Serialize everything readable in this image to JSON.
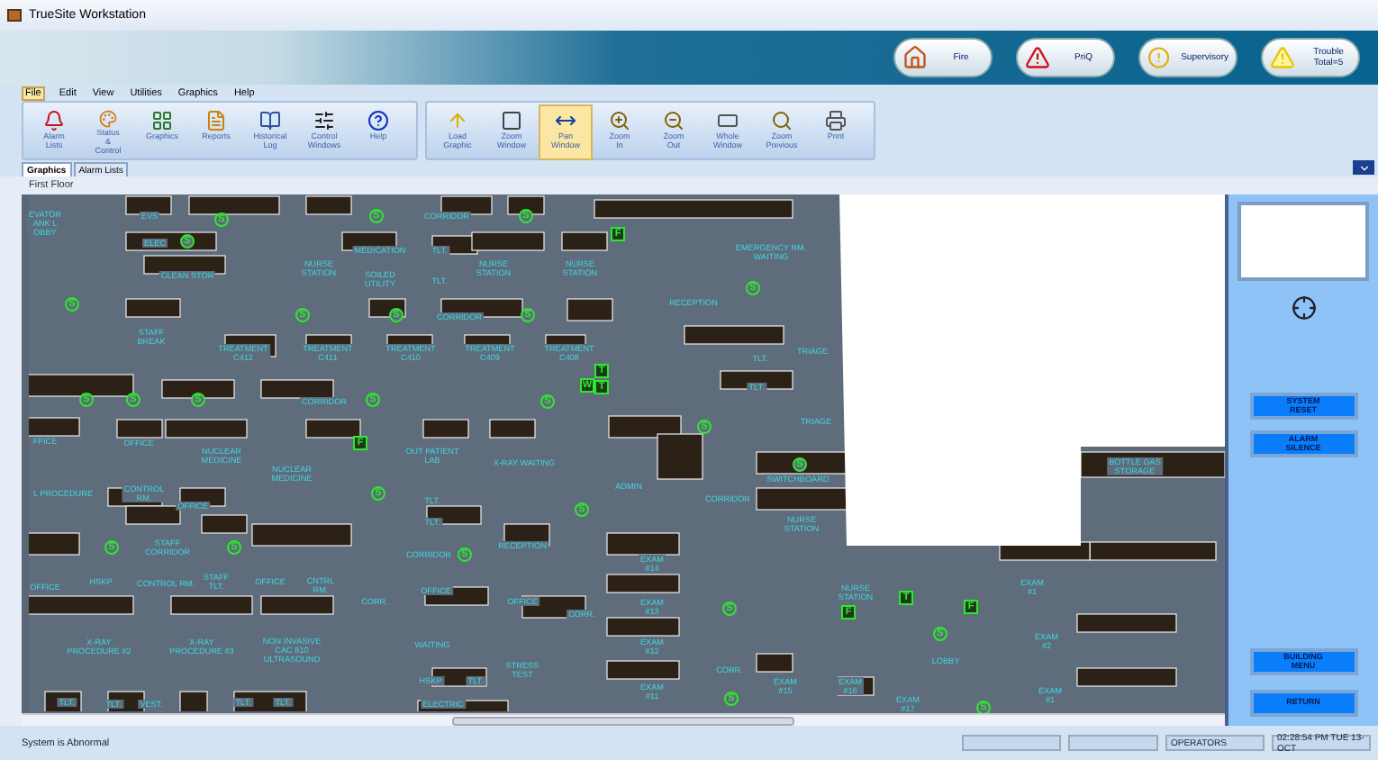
{
  "window": {
    "title": "TrueSite Workstation"
  },
  "alarm_buttons": [
    {
      "kind": "fire",
      "label": "Fire"
    },
    {
      "kind": "priority",
      "label": "PriQ"
    },
    {
      "kind": "supervisory",
      "label": "Supervisory"
    },
    {
      "kind": "trouble",
      "label": "Trouble\nTotal=5"
    }
  ],
  "menu": [
    {
      "label": "File",
      "selected": true
    },
    {
      "label": "Edit",
      "selected": false
    },
    {
      "label": "View",
      "selected": false
    },
    {
      "label": "Utilities",
      "selected": false
    },
    {
      "label": "Graphics",
      "selected": false
    },
    {
      "label": "Help",
      "selected": false
    }
  ],
  "toolbar_groups": [
    [
      {
        "kind": "alarm",
        "label": "Alarm\nLists",
        "selected": false
      },
      {
        "kind": "status",
        "label": "Status &\nControl",
        "selected": false
      },
      {
        "kind": "graphics",
        "label": "Graphics",
        "selected": false
      },
      {
        "kind": "reports",
        "label": "Reports",
        "selected": false
      },
      {
        "kind": "log",
        "label": "Historical\nLog",
        "selected": false
      },
      {
        "kind": "control",
        "label": "Control\nWindows",
        "selected": false
      },
      {
        "kind": "help",
        "label": "Help",
        "selected": false
      }
    ],
    [
      {
        "kind": "load",
        "label": "Load\nGraphic",
        "selected": false
      },
      {
        "kind": "zoomwindow",
        "label": "Zoom\nWindow",
        "selected": false
      },
      {
        "kind": "pan",
        "label": "Pan\nWindow",
        "selected": true
      },
      {
        "kind": "zoomin",
        "label": "Zoom\nIn",
        "selected": false
      },
      {
        "kind": "zoomout",
        "label": "Zoom\nOut",
        "selected": false
      },
      {
        "kind": "whole",
        "label": "Whole\nWindow",
        "selected": false
      },
      {
        "kind": "zoomprev",
        "label": "Zoom\nPrevious",
        "selected": false
      },
      {
        "kind": "print",
        "label": "Print",
        "selected": false
      }
    ]
  ],
  "tabs": [
    {
      "label": "Graphics",
      "selected": true
    },
    {
      "label": "Alarm Lists",
      "selected": false
    }
  ],
  "floor": {
    "title": "First Floor",
    "rooms": [
      "EVATOR\nANK L\nOBBY",
      "EVS",
      "CORRIDOR",
      "ELEC",
      "MEDICATION",
      "TLT.",
      "CLEAN STOR",
      "NURSE\nSTATION",
      "SOILED\nUTILITY",
      "TLT.",
      "NURSE\nSTATION",
      "NURSE\nSTATION",
      "CORRIDOR",
      "STAFF\nBREAK",
      "TREATMENT\nC412",
      "TREATMENT\nC411",
      "TREATMENT\nC410",
      "TREATMENT\nC409",
      "TREATMENT\nC408",
      "CORRIDOR",
      "FFICE",
      "OFFICE",
      "NUCLEAR\nMEDICINE",
      "OUT PATIENT\nLAB",
      "X-RAY WAITING",
      "NUCLEAR\nMEDICINE",
      "L PROCEDURE",
      "CONTROL\nRM.",
      "OFFICE",
      "TLT.",
      "TLT.",
      "STAFF\nCORRIDOR",
      "CORRIDOR",
      "RECEPTION",
      "OFFICE",
      "HSKP",
      "CONTROL RM.",
      "STAFF\nTLT.",
      "OFFICE",
      "CNTRL\nRM.",
      "CORR.",
      "OFFICE",
      "OFFICE",
      "CORR.",
      "X-RAY\nPROCEDURE #2",
      "X-RAY\nPROCEDURE #3",
      "NON INVASIVE\nCAC 810\nULTRASOUND",
      "WAITING",
      "STRESS\nTEST",
      "HSKP",
      "TLT.",
      "TLT.",
      "TLT.",
      "VEST.",
      "TLT.",
      "TLT.",
      "ELECTRIC",
      "EMERGENCY RM.\nWAITING",
      "RECEPTION",
      "TLT.",
      "TRIAGE",
      "TLT.",
      "TRIAGE",
      "SWITCHBOARD",
      "ADMIN",
      "CORRIDOR",
      "NURSE\nSTATION",
      "BOTTLE GAS\nSTORAGE",
      "EXAM\n#14",
      "EXAM\n#1",
      "NURSE\nSTATION",
      "EXAM\n#13",
      "EXAM\n#12",
      "EXAM\n#2",
      "LOBBY",
      "EXAM\n#11",
      "CORR.",
      "EXAM\n#15",
      "EXAM\n#16",
      "EXAM\n#17",
      "EXAM\n#1"
    ],
    "devices": [
      {
        "kind": "detector",
        "symbol": "S"
      },
      {
        "kind": "detector",
        "symbol": "S"
      },
      {
        "kind": "detector",
        "symbol": "S"
      },
      {
        "kind": "detector",
        "symbol": "S"
      },
      {
        "kind": "detector",
        "symbol": "S"
      },
      {
        "kind": "detector",
        "symbol": "S"
      },
      {
        "kind": "detector",
        "symbol": "S"
      },
      {
        "kind": "detector",
        "symbol": "S"
      },
      {
        "kind": "detector",
        "symbol": "S"
      },
      {
        "kind": "detector",
        "symbol": "S"
      },
      {
        "kind": "detector",
        "symbol": "S"
      },
      {
        "kind": "detector",
        "symbol": "S"
      },
      {
        "kind": "detector",
        "symbol": "S"
      },
      {
        "kind": "detector",
        "symbol": "S"
      },
      {
        "kind": "detector",
        "symbol": "S"
      },
      {
        "kind": "detector",
        "symbol": "S"
      },
      {
        "kind": "detector",
        "symbol": "S"
      },
      {
        "kind": "detector",
        "symbol": "S"
      },
      {
        "kind": "detector",
        "symbol": "S"
      },
      {
        "kind": "detector",
        "symbol": "S"
      },
      {
        "kind": "detector",
        "symbol": "S"
      },
      {
        "kind": "detector",
        "symbol": "S"
      },
      {
        "kind": "detector",
        "symbol": "S"
      },
      {
        "kind": "detector",
        "symbol": "S"
      },
      {
        "kind": "detector",
        "symbol": "S"
      },
      {
        "kind": "module",
        "symbol": "F"
      },
      {
        "kind": "module",
        "symbol": "F"
      },
      {
        "kind": "module",
        "symbol": "F"
      },
      {
        "kind": "module",
        "symbol": "F"
      },
      {
        "kind": "module",
        "symbol": "T"
      },
      {
        "kind": "module",
        "symbol": "T"
      },
      {
        "kind": "module",
        "symbol": "W"
      },
      {
        "kind": "module",
        "symbol": "T"
      }
    ]
  },
  "side_panel": {
    "buttons": [
      "SYSTEM\nRESET",
      "ALARM\nSILENCE",
      "BUILDING\nMENU",
      "RETURN"
    ]
  },
  "status_bar": {
    "message": "System is Abnormal",
    "user": "OPERATORS",
    "time": "02:28:54 PM TUE 13-OCT"
  }
}
